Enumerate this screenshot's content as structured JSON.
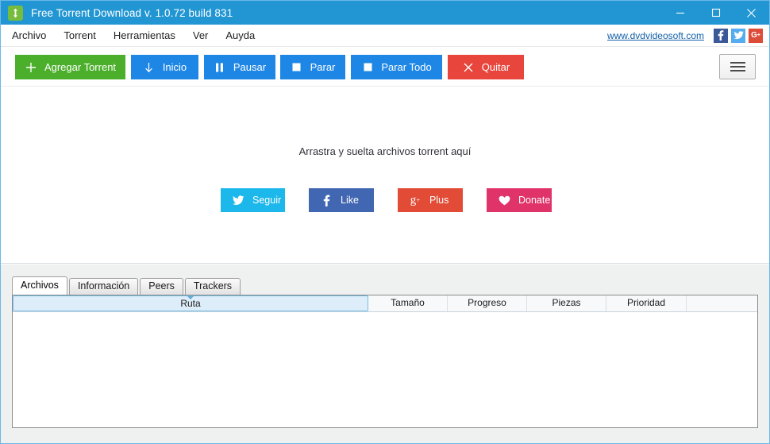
{
  "window": {
    "title": "Free Torrent Download v. 1.0.72 build 831",
    "app_icon": "download-arrows-icon",
    "controls": {
      "minimize": "minimize-icon",
      "maximize": "maximize-icon",
      "close": "close-icon"
    },
    "accent_color": "#2196d3",
    "border_color": "#6bb9e8"
  },
  "menubar": {
    "items": [
      {
        "label": "Archivo"
      },
      {
        "label": "Torrent"
      },
      {
        "label": "Herramientas"
      },
      {
        "label": "Ver"
      },
      {
        "label": "Auyda"
      }
    ],
    "site_link": "www.dvdvideosoft.com",
    "social": [
      {
        "name": "facebook-icon",
        "glyph": "f",
        "color": "#3b5998"
      },
      {
        "name": "twitter-icon",
        "glyph": "ὂ6",
        "color": "#55acee"
      },
      {
        "name": "google-plus-icon",
        "glyph": "G+",
        "color": "#dd4b39"
      }
    ]
  },
  "toolbar": {
    "buttons": [
      {
        "label": "Agregar Torrent",
        "icon": "plus-icon",
        "color": "#4caf2b"
      },
      {
        "label": "Inicio",
        "icon": "download-arrow-icon",
        "color": "#1e87e5"
      },
      {
        "label": "Pausar",
        "icon": "pause-icon",
        "color": "#1e87e5"
      },
      {
        "label": "Parar",
        "icon": "stop-icon",
        "color": "#1e87e5"
      },
      {
        "label": "Parar Todo",
        "icon": "stop-icon",
        "color": "#1e87e5"
      },
      {
        "label": "Quitar",
        "icon": "close-x-icon",
        "color": "#e8453c"
      }
    ],
    "menu_button": "hamburger-menu-icon"
  },
  "droparea": {
    "hint": "Arrastra y suelta archivos torrent aquí",
    "social_buttons": [
      {
        "label": "Seguir",
        "icon": "twitter-bird-icon",
        "color": "#1cb7eb"
      },
      {
        "label": "Like",
        "icon": "facebook-f-icon",
        "color": "#4267b2"
      },
      {
        "label": "Plus",
        "icon": "google-plus-icon",
        "color": "#e24b36"
      },
      {
        "label": "Donate",
        "icon": "heart-icon",
        "color": "#e0336a"
      }
    ]
  },
  "bottom": {
    "tabs": [
      {
        "label": "Archivos",
        "active": true
      },
      {
        "label": "Información",
        "active": false
      },
      {
        "label": "Peers",
        "active": false
      },
      {
        "label": "Trackers",
        "active": false
      }
    ],
    "table": {
      "columns": [
        {
          "label": "Ruta",
          "sorted": true,
          "sort_direction": "asc"
        },
        {
          "label": "Tamaño",
          "sorted": false
        },
        {
          "label": "Progreso",
          "sorted": false
        },
        {
          "label": "Piezas",
          "sorted": false
        },
        {
          "label": "Prioridad",
          "sorted": false
        },
        {
          "label": "",
          "sorted": false
        }
      ],
      "rows": []
    }
  }
}
